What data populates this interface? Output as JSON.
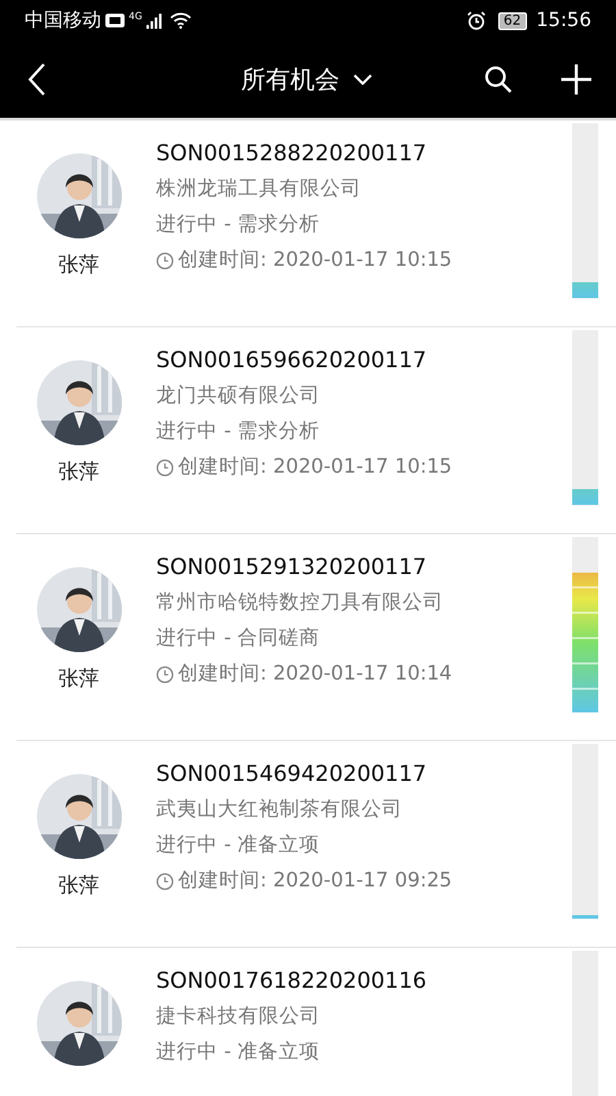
{
  "status_bar": {
    "carrier": "中国移动",
    "network": "4G",
    "battery": "62",
    "time": "15:56"
  },
  "nav": {
    "title": "所有机会"
  },
  "opportunities": [
    {
      "code": "SON0015288220200117",
      "company": "株洲龙瑞工具有限公司",
      "status": "进行中 - 需求分析",
      "created": "创建时间: 2020-01-17 10:15",
      "owner": "张萍",
      "level": 0.09
    },
    {
      "code": "SON0016596620200117",
      "company": "龙门共硕有限公司",
      "status": "进行中 - 需求分析",
      "created": "创建时间: 2020-01-17 10:15",
      "owner": "张萍",
      "level": 0.09
    },
    {
      "code": "SON0015291320200117",
      "company": "常州市哈锐特数控刀具有限公司",
      "status": "进行中 - 合同磋商",
      "created": "创建时间: 2020-01-17 10:14",
      "owner": "张萍",
      "level": 0.8
    },
    {
      "code": "SON0015469420200117",
      "company": "武夷山大红袍制茶有限公司",
      "status": "进行中 - 准备立项",
      "created": "创建时间: 2020-01-17 09:25",
      "owner": "张萍",
      "level": 0.02
    },
    {
      "code": "SON0017618220200116",
      "company": "捷卡科技有限公司",
      "status": "进行中 - 准备立项"
    }
  ]
}
